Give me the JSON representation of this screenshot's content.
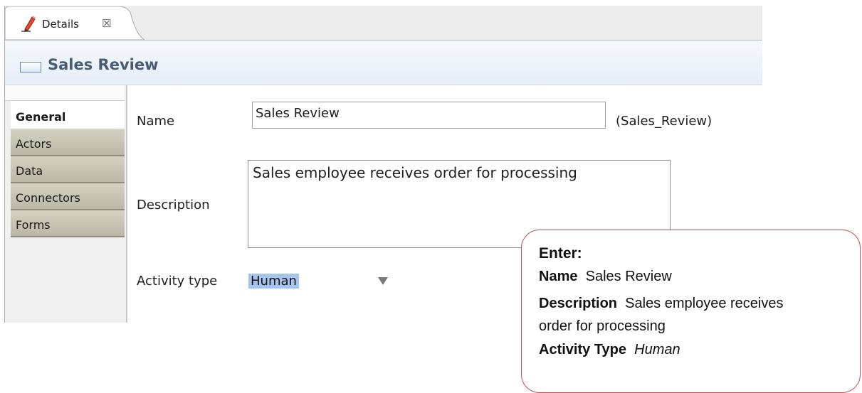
{
  "tab": {
    "label": "Details",
    "close_glyph": "☒"
  },
  "header": {
    "title": "Sales Review",
    "icon": "element-icon"
  },
  "sidebar": {
    "items": [
      {
        "label": "General",
        "active": true
      },
      {
        "label": "Actors",
        "active": false
      },
      {
        "label": "Data",
        "active": false
      },
      {
        "label": "Connectors",
        "active": false
      },
      {
        "label": "Forms",
        "active": false
      }
    ]
  },
  "form": {
    "name_label": "Name",
    "name_value": "Sales Review",
    "name_id": "(Sales_Review)",
    "description_label": "Description",
    "description_value": "Sales employee receives order for processing",
    "activity_type_label": "Activity type",
    "activity_type_value": "Human"
  },
  "callout": {
    "title": "Enter:",
    "name_key": "Name",
    "name_val": "Sales Review",
    "description_key": "Description",
    "description_val_line1": "Sales employee receives",
    "description_val_line2": "order for processing",
    "activity_type_key": "Activity Type",
    "activity_type_val": "Human",
    "border_color": "#c0504d"
  },
  "colors": {
    "selection": "#a6c5ee",
    "header_text": "#475b73"
  }
}
